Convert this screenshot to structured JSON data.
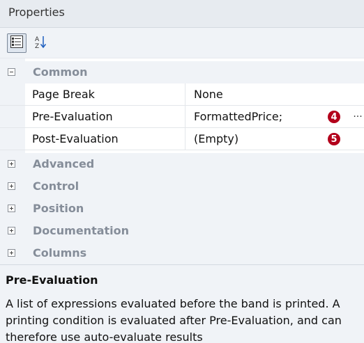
{
  "panel": {
    "title": "Properties"
  },
  "toolbar": {
    "categorized_icon": "categorized-view-icon",
    "alphabetical_icon": "sort-alphabetical-icon"
  },
  "grid": {
    "common": {
      "label": "Common",
      "expanded": true,
      "rows": [
        {
          "name": "Page Break",
          "value": "None"
        },
        {
          "name": "Pre-Evaluation",
          "value": "FormattedPrice;",
          "marker": "4",
          "has_ellipsis": true,
          "ellipsis": "..."
        },
        {
          "name": "Post-Evaluation",
          "value": "(Empty)",
          "marker": "5"
        }
      ]
    },
    "collapsed_categories": [
      {
        "label": "Advanced"
      },
      {
        "label": "Control"
      },
      {
        "label": "Position"
      },
      {
        "label": "Documentation"
      },
      {
        "label": "Columns"
      }
    ]
  },
  "description": {
    "title": "Pre-Evaluation",
    "text": "A list of expressions evaluated before the band is printed. A printing condition is evaluated after Pre-Evaluation, and can therefore use auto-evaluate results"
  },
  "colors": {
    "marker": "#b3001b",
    "category_text": "#858d99",
    "panel_background": "#f0f3f7"
  }
}
